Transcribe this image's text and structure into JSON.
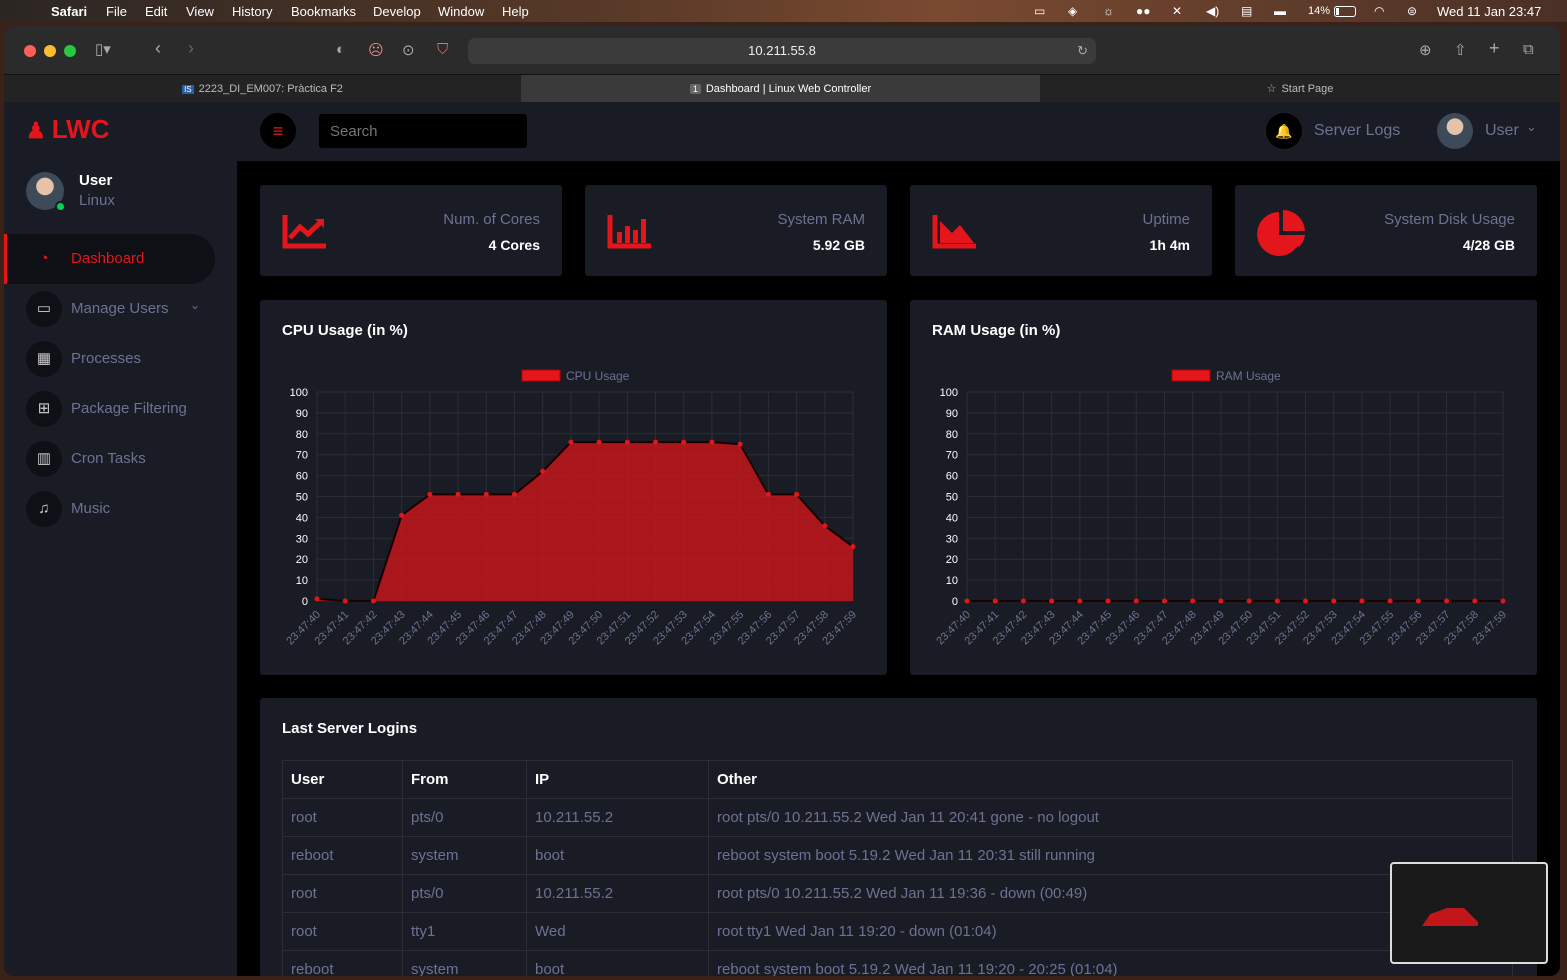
{
  "menubar": {
    "app": "Safari",
    "items": [
      "File",
      "Edit",
      "View",
      "History",
      "Bookmarks",
      "Develop",
      "Window",
      "Help"
    ],
    "battery": "14%",
    "clock": "Wed 11 Jan  23:47"
  },
  "browser": {
    "url": "10.211.55.8",
    "tabs": [
      {
        "label": "2223_DI_EM007: Pràctica F2",
        "active": false
      },
      {
        "label": "Dashboard | Linux Web Controller",
        "active": true,
        "badge": "1"
      },
      {
        "label": "Start Page",
        "active": false
      }
    ]
  },
  "app": {
    "brand": "LWC",
    "accent": "#e5161b",
    "search_placeholder": "Search",
    "server_logs": "Server Logs",
    "top_user": "User",
    "profile": {
      "name": "User",
      "role": "Linux"
    },
    "nav": [
      {
        "label": "Dashboard",
        "icon": "dashboard-icon",
        "active": true
      },
      {
        "label": "Manage Users",
        "icon": "laptop-icon",
        "active": false,
        "expandable": true
      },
      {
        "label": "Processes",
        "icon": "grid-icon",
        "active": false
      },
      {
        "label": "Package Filtering",
        "icon": "table-icon",
        "active": false
      },
      {
        "label": "Cron Tasks",
        "icon": "bar-chart-icon",
        "active": false
      },
      {
        "label": "Music",
        "icon": "music-icon",
        "active": false
      }
    ],
    "stats": [
      {
        "label": "Num. of Cores",
        "value": "4 Cores",
        "icon": "trend-icon"
      },
      {
        "label": "System RAM",
        "value": "5.92 GB",
        "icon": "bars-icon"
      },
      {
        "label": "Uptime",
        "value": "1h 4m",
        "icon": "area-icon"
      },
      {
        "label": "System Disk Usage",
        "value": "4/28 GB",
        "icon": "pie-icon"
      }
    ]
  },
  "chart_data": [
    {
      "type": "area",
      "title": "CPU Usage (in %)",
      "legend": "CPU Usage",
      "x": [
        "23:47:40",
        "23:47:41",
        "23:47:42",
        "23:47:43",
        "23:47:44",
        "23:47:45",
        "23:47:46",
        "23:47:47",
        "23:47:48",
        "23:47:49",
        "23:47:50",
        "23:47:51",
        "23:47:52",
        "23:47:53",
        "23:47:54",
        "23:47:55",
        "23:47:56",
        "23:47:57",
        "23:47:58",
        "23:47:59"
      ],
      "values": [
        1,
        0,
        0,
        41,
        51,
        51,
        51,
        51,
        62,
        76,
        76,
        76,
        76,
        76,
        76,
        75,
        51,
        51,
        36,
        26
      ],
      "ylim": [
        0,
        100
      ],
      "yticks": [
        0,
        10,
        20,
        30,
        40,
        50,
        60,
        70,
        80,
        90,
        100
      ],
      "grid": true,
      "color": "#e5161b"
    },
    {
      "type": "area",
      "title": "RAM Usage (in %)",
      "legend": "RAM Usage",
      "x": [
        "23:47:40",
        "23:47:41",
        "23:47:42",
        "23:47:43",
        "23:47:44",
        "23:47:45",
        "23:47:46",
        "23:47:47",
        "23:47:48",
        "23:47:49",
        "23:47:50",
        "23:47:51",
        "23:47:52",
        "23:47:53",
        "23:47:54",
        "23:47:55",
        "23:47:56",
        "23:47:57",
        "23:47:58",
        "23:47:59"
      ],
      "values": [
        0,
        0,
        0,
        0,
        0,
        0,
        0,
        0,
        0,
        0,
        0,
        0,
        0,
        0,
        0,
        0,
        0,
        0,
        0,
        0
      ],
      "ylim": [
        0,
        100
      ],
      "yticks": [
        0,
        10,
        20,
        30,
        40,
        50,
        60,
        70,
        80,
        90,
        100
      ],
      "grid": true,
      "color": "#e5161b"
    }
  ],
  "logins": {
    "title": "Last Server Logins",
    "columns": [
      "User",
      "From",
      "IP",
      "Other"
    ],
    "rows": [
      [
        "root",
        "pts/0",
        "10.211.55.2",
        "root pts/0 10.211.55.2 Wed Jan 11 20:41 gone - no logout"
      ],
      [
        "reboot",
        "system",
        "boot",
        "reboot system boot 5.19.2 Wed Jan 11 20:31 still running"
      ],
      [
        "root",
        "pts/0",
        "10.211.55.2",
        "root pts/0 10.211.55.2 Wed Jan 11 19:36 - down (00:49)"
      ],
      [
        "root",
        "tty1",
        "Wed",
        "root tty1 Wed Jan 11 19:20 - down (01:04)"
      ],
      [
        "reboot",
        "system",
        "boot",
        "reboot system boot 5.19.2 Wed Jan 11 19:20 - 20:25 (01:04)"
      ]
    ]
  }
}
